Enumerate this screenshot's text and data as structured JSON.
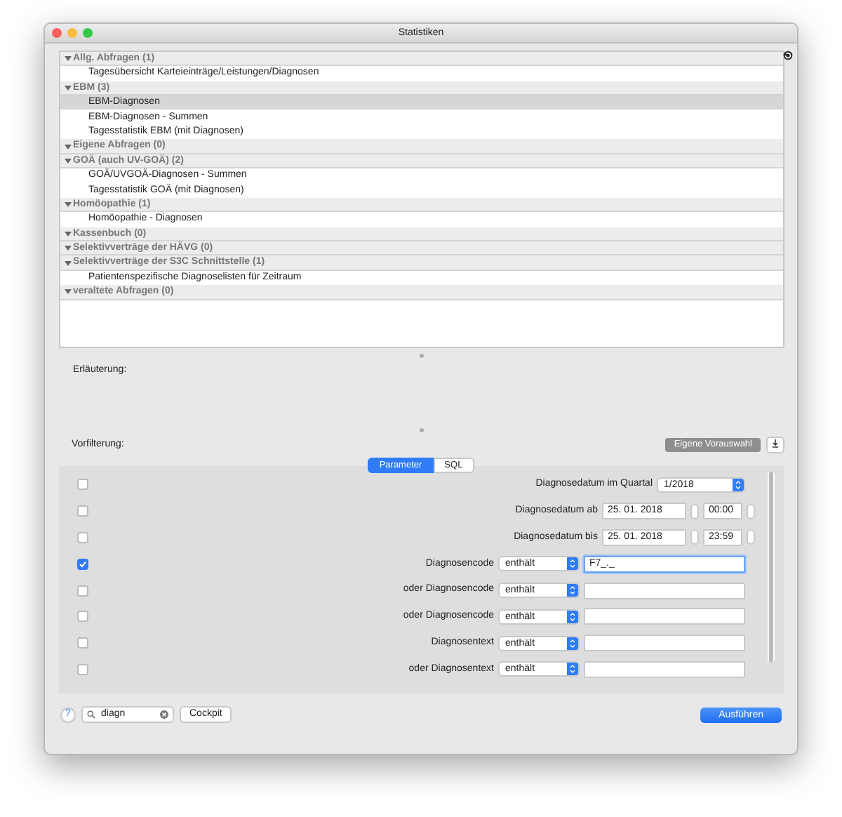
{
  "window": {
    "title": "Statistiken"
  },
  "tree": [
    {
      "label": "Allg. Abfragen (1)",
      "expanded": true,
      "children": [
        {
          "label": "Tagesübersicht Karteieinträge/Leistungen/Diagnosen",
          "selected": false
        }
      ]
    },
    {
      "label": "EBM (3)",
      "expanded": true,
      "children": [
        {
          "label": "EBM-Diagnosen",
          "selected": true
        },
        {
          "label": "EBM-Diagnosen - Summen",
          "selected": false
        },
        {
          "label": "Tagesstatistik EBM (mit Diagnosen)",
          "selected": false
        }
      ]
    },
    {
      "label": "Eigene Abfragen (0)",
      "expanded": true
    },
    {
      "label": "GOÄ (auch UV-GOÄ) (2)",
      "expanded": true,
      "children": [
        {
          "label": "GOÄ/UVGOÄ-Diagnosen - Summen",
          "selected": false
        },
        {
          "label": "Tagesstatistik GOÄ (mit Diagnosen)",
          "selected": false
        }
      ]
    },
    {
      "label": "Homöopathie (1)",
      "expanded": true,
      "children": [
        {
          "label": "Homöopathie - Diagnosen",
          "selected": false
        }
      ]
    },
    {
      "label": "Kassenbuch (0)",
      "expanded": true
    },
    {
      "label": "Selektivverträge der HÄVG (0)",
      "expanded": true
    },
    {
      "label": "Selektivverträge der S3C Schnittstelle (1)",
      "expanded": true,
      "children": [
        {
          "label": "Patientenspezifische Diagnoselisten für Zeitraum",
          "selected": false
        }
      ]
    },
    {
      "label": "veraltete Abfragen (0)",
      "expanded": true
    }
  ],
  "explanation_label": "Erläuterung:",
  "prefilter": {
    "label": "Vorfilterung:",
    "button": "Eigene Vorauswahl"
  },
  "tabs": [
    {
      "label": "Parameter",
      "selected": true
    },
    {
      "label": "SQL",
      "selected": false
    }
  ],
  "parameters": [
    {
      "kind": "select",
      "checked": false,
      "label": "Diagnosedatum im Quartal",
      "value": "1/2018"
    },
    {
      "kind": "datetime",
      "checked": false,
      "label": "Diagnosedatum ab",
      "date": "25. 01. 2018",
      "time": "00:00"
    },
    {
      "kind": "datetime",
      "checked": false,
      "label": "Diagnosedatum bis",
      "date": "25. 01. 2018",
      "time": "23:59"
    },
    {
      "kind": "match",
      "checked": true,
      "label": "Diagnosencode",
      "operator": "enthält",
      "value": "F7_._"
    },
    {
      "kind": "match",
      "checked": false,
      "label": "oder Diagnosencode",
      "operator": "enthält"
    },
    {
      "kind": "match",
      "checked": false,
      "label": "oder Diagnosencode",
      "operator": "enthält"
    },
    {
      "kind": "match",
      "checked": false,
      "label": "Diagnosentext",
      "operator": "enthält"
    },
    {
      "kind": "match",
      "checked": false,
      "label": "oder Diagnosentext",
      "operator": "enthält"
    }
  ],
  "footer": {
    "help": "?",
    "search": "diagn",
    "cockpit": "Cockpit",
    "run": "Ausführen"
  }
}
